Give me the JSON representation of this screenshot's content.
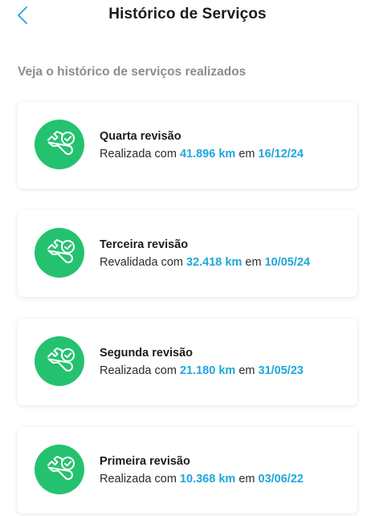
{
  "header": {
    "title": "Histórico de Serviços",
    "back_icon": "chevron-left-icon",
    "accent_color": "#1ea7d9"
  },
  "subtitle": "Veja o histórico de serviços realizados",
  "icon_badge_color": "#24c26f",
  "services": [
    {
      "name": "Quarta revisão",
      "status": "Realizada com",
      "km": "41.896 km",
      "connector": "em",
      "date": "16/12/24",
      "icon": "wrench-check-icon"
    },
    {
      "name": "Terceira revisão",
      "status": "Revalidada com",
      "km": "32.418 km",
      "connector": "em",
      "date": "10/05/24",
      "icon": "wrench-check-icon"
    },
    {
      "name": "Segunda revisão",
      "status": "Realizada com",
      "km": "21.180 km",
      "connector": "em",
      "date": "31/05/23",
      "icon": "wrench-check-icon"
    },
    {
      "name": "Primeira revisão",
      "status": "Realizada com",
      "km": "10.368 km",
      "connector": "em",
      "date": "03/06/22",
      "icon": "wrench-check-icon"
    }
  ]
}
